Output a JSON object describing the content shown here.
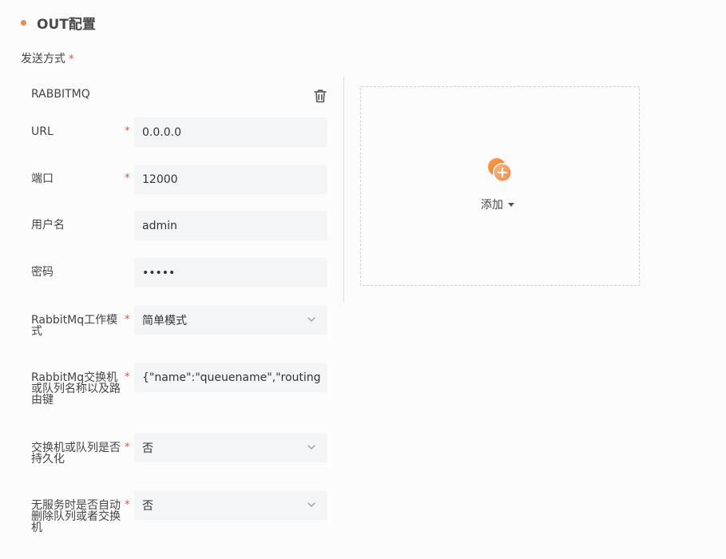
{
  "section": {
    "title": "OUT配置"
  },
  "send_mode": {
    "label": "发送方式",
    "required_mark": "*"
  },
  "card": {
    "title": "RABBITMQ",
    "fields": [
      {
        "label": "URL",
        "required": true,
        "value": "0.0.0.0",
        "type": "input"
      },
      {
        "label": "端口",
        "required": true,
        "value": "12000",
        "type": "input"
      },
      {
        "label": "用户名",
        "required": false,
        "value": "admin",
        "type": "input"
      },
      {
        "label": "密码",
        "required": false,
        "value": "•••••",
        "type": "password"
      },
      {
        "label": "RabbitMq工作模式",
        "required": true,
        "value": "简单模式",
        "type": "select"
      },
      {
        "label": "RabbitMq交换机或队列名称以及路由键",
        "required": true,
        "value": "{\"name\":\"queuename\",\"routing",
        "type": "input"
      },
      {
        "label": "交换机或队列是否持久化",
        "required": true,
        "value": "否",
        "type": "select"
      },
      {
        "label": "无服务时是否自动删除队列或者交换机",
        "required": true,
        "value": "否",
        "type": "select"
      }
    ]
  },
  "add_panel": {
    "label": "添加"
  },
  "colors": {
    "accent": "#f5873a",
    "required": "#e84b4b",
    "field_bg": "#f4f5f7"
  },
  "icons": {
    "trash": "trash-icon",
    "add": "add-circle-icon",
    "chevron": "chevron-down-icon"
  }
}
